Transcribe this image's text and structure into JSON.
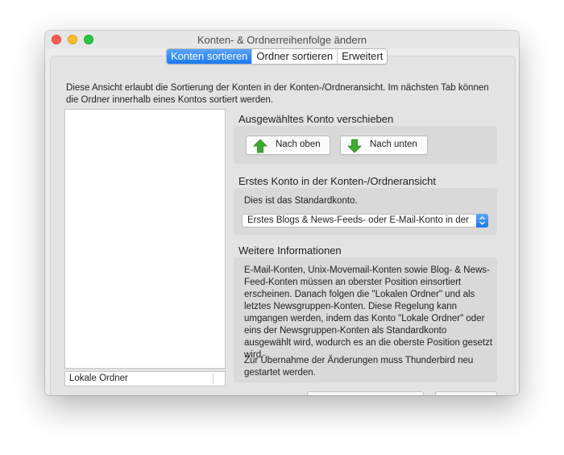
{
  "window": {
    "title": "Konten- & Ordnerreihenfolge ändern"
  },
  "tabs": [
    {
      "label": "Konten sortieren",
      "active": true
    },
    {
      "label": "Ordner sortieren",
      "active": false
    },
    {
      "label": "Erweitert",
      "active": false
    }
  ],
  "intro_text": "Diese Ansicht erlaubt die Sortierung der Konten in der Konten-/Ordneransicht. Im nächsten Tab können die Ordner innerhalb eines Kontos sortiert werden.",
  "account_list": {
    "header": "Lokale Ordner"
  },
  "move_section": {
    "title": "Ausgewähltes Konto verschieben",
    "up_label": "Nach oben",
    "down_label": "Nach unten",
    "up_icon": "green-arrow-up-icon",
    "down_icon": "green-arrow-down-icon"
  },
  "first_account_section": {
    "title": "Erstes Konto in der Konten-/Ordneransicht",
    "note": "Dies ist das Standardkonto.",
    "select_value": "Erstes Blogs & News-Feeds- oder E-Mail-Konto in der Liste"
  },
  "info_section": {
    "title": "Weitere Informationen",
    "para1": "E-Mail-Konten, Unix-Movemail-Konten sowie Blog- & News-Feed-Konten müssen an oberster Position einsortiert erscheinen. Danach folgen die \"Lokalen Ordner\" und als letztes Newsgruppen-Konten. Diese Regelung kann umgangen werden, indem das Konto \"Lokale Ordner\" oder eins der Newsgruppen-Konten als Standardkonto ausgewählt wird, wodurch es an die oberste Position gesetzt wird.",
    "para2": "Zur Übernahme der Änderungen muss Thunderbird neu gestartet werden."
  },
  "colors": {
    "accent": "#1a79f2",
    "arrow_green": "#3dab2e",
    "close": "#fd5d56",
    "minimize": "#fdbc2e",
    "maximize": "#29c840"
  }
}
